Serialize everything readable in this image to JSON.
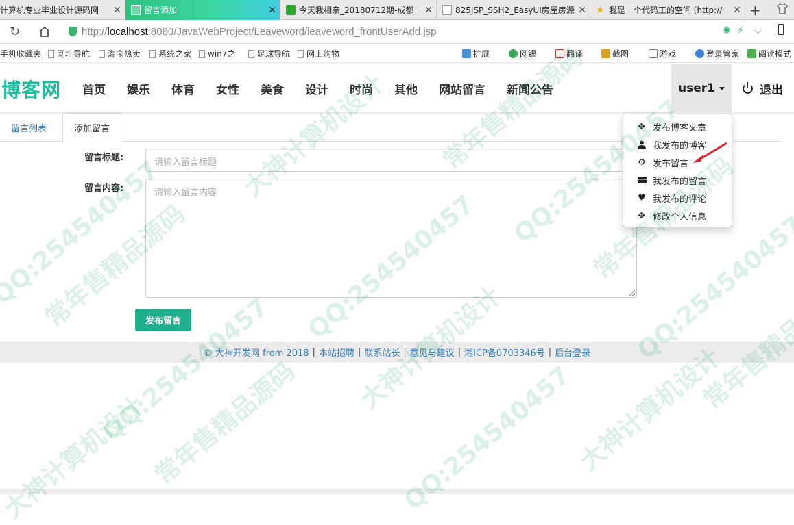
{
  "browser": {
    "tabs": [
      {
        "label": "计算机专业毕业设计源码网",
        "active": false
      },
      {
        "label": "留言添加",
        "active": true
      },
      {
        "label": "今天我相亲_20180712期-成都",
        "active": false
      },
      {
        "label": "825JSP_SSH2_EasyUI房屋房源",
        "active": false
      },
      {
        "label": "我是一个代码工的空间 [http://",
        "active": false
      }
    ],
    "new_tab": "+",
    "url_prefix": "http://",
    "url_host": "localhost",
    "url_rest": ":8080/JavaWebProject/Leaveword/leaveword_frontUserAdd.jsp",
    "bookmarks": [
      "手机收藏夹",
      "网址导航",
      "淘宝热卖",
      "系统之家",
      "win7之",
      "足球导航",
      "网上购物"
    ],
    "extensions": [
      "扩展",
      "网银",
      "翻译",
      "截图",
      "游戏",
      "登录管家",
      "阅读模式"
    ]
  },
  "site": {
    "brand": "博客网",
    "nav": [
      "首页",
      "娱乐",
      "体育",
      "女性",
      "美食",
      "设计",
      "时尚",
      "其他",
      "网站留言",
      "新闻公告"
    ],
    "user": "user1",
    "logout": "退出"
  },
  "dropdown": [
    {
      "label": "发布博客文章",
      "icon": "move-icon"
    },
    {
      "label": "我发布的博客",
      "icon": "user-icon"
    },
    {
      "label": "发布留言",
      "icon": "gear-icon"
    },
    {
      "label": "我发布的留言",
      "icon": "card-icon"
    },
    {
      "label": "我发布的评论",
      "icon": "heart-icon"
    },
    {
      "label": "修改个人信息",
      "icon": "move-icon"
    }
  ],
  "tabs": {
    "list": "留言列表",
    "add": "添加留言"
  },
  "form": {
    "title_label": "留言标题:",
    "title_placeholder": "请输入留言标题",
    "content_label": "留言内容:",
    "content_placeholder": "请输入留言内容",
    "submit": "发布留言"
  },
  "footer": {
    "copyright": "© 大神开发网 from 2018",
    "links": [
      "本站招聘",
      "联系站长",
      "意见与建议",
      "湘ICP备0703346号",
      "后台登录"
    ]
  },
  "watermarks": [
    "QQ:254540457",
    "大神计算机设计",
    "常年售精品源码"
  ],
  "colors": {
    "brand": "#1fbb9d",
    "submit": "#1fae8c",
    "link": "#337ab7",
    "active_tab": "#2ec27e"
  }
}
